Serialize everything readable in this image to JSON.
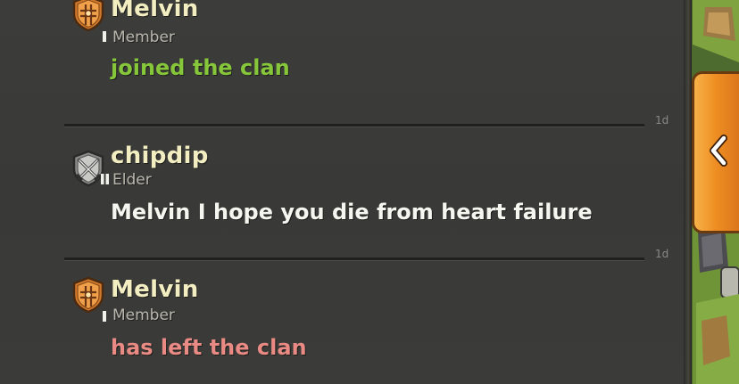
{
  "messages": [
    {
      "name": "Melvin",
      "role": "Member",
      "text": "joined the clan",
      "badge": "orange-shield-badge-icon"
    },
    {
      "name": "chipdip",
      "role": "Elder",
      "text": "Melvin I hope you die from heart failure",
      "badge": "crossed-swords-badge-icon"
    },
    {
      "name": "Melvin",
      "role": "Member",
      "text": "has left the clan",
      "badge": "orange-shield-badge-icon"
    }
  ],
  "timestamps": [
    "1d",
    "1d"
  ],
  "colors": {
    "background": "#3a3a38",
    "name": "#f3eec2",
    "joined_text": "#86c63a",
    "chat_text": "#f6f6f1",
    "left_text": "#e98a84",
    "tab_orange": "#ee8e22"
  },
  "collapse_tab": {
    "icon": "chevron-left-icon"
  }
}
